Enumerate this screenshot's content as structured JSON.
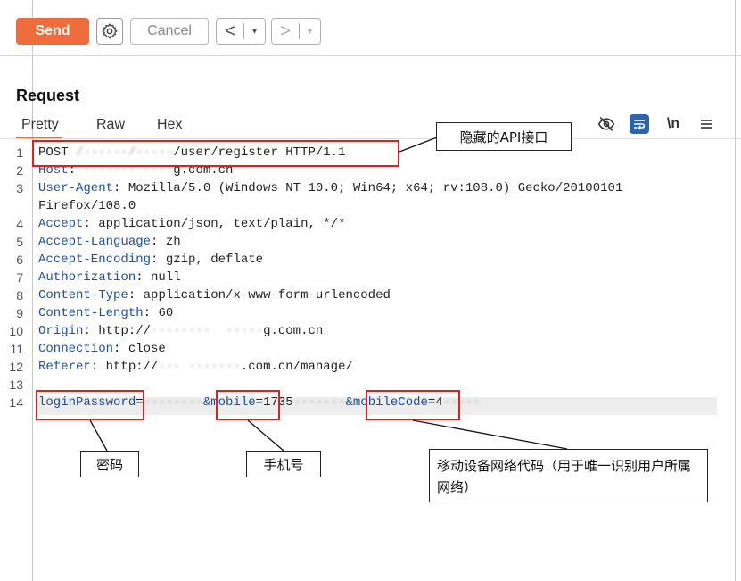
{
  "toolbar": {
    "send_label": "Send",
    "cancel_label": "Cancel",
    "back_glyph": "<",
    "forward_glyph": ">",
    "dropdown_glyph": "▾"
  },
  "request": {
    "title": "Request",
    "tabs": [
      "Pretty",
      "Raw",
      "Hex"
    ],
    "active_tab": "Pretty",
    "icons": [
      "eye-slash-icon",
      "wrap-lines-icon",
      "newline-icon",
      "menu-icon"
    ],
    "newline_label": "\\n"
  },
  "lines": [
    {
      "n": "1",
      "key": "",
      "text": "POST ",
      "blur": "/······/·····",
      "rest": "/user/register HTTP/1.1"
    },
    {
      "n": "2",
      "key": "Host",
      "sep": ": ",
      "blur": "······· ····",
      "rest": "g.com.cn"
    },
    {
      "n": "3",
      "key": "User-Agent",
      "sep": ": ",
      "text": "Mozilla/5.0 (Windows NT 10.0; Win64; x64; rv:108.0) Gecko/20100101"
    },
    {
      "n": "",
      "key": "",
      "text": "Firefox/108.0"
    },
    {
      "n": "4",
      "key": "Accept",
      "sep": ": ",
      "text": "application/json, text/plain, */*"
    },
    {
      "n": "5",
      "key": "Accept-Language",
      "sep": ": ",
      "text": "zh"
    },
    {
      "n": "6",
      "key": "Accept-Encoding",
      "sep": ": ",
      "text": "gzip, deflate"
    },
    {
      "n": "7",
      "key": "Authorization",
      "sep": ": ",
      "text": "null"
    },
    {
      "n": "8",
      "key": "Content-Type",
      "sep": ": ",
      "text": "application/x-www-form-urlencoded"
    },
    {
      "n": "9",
      "key": "Content-Length",
      "sep": ": ",
      "text": "60"
    },
    {
      "n": "10",
      "key": "Origin",
      "sep": ": ",
      "text": "http://",
      "blur": "········  ·····",
      "rest": "g.com.cn"
    },
    {
      "n": "11",
      "key": "Connection",
      "sep": ": ",
      "text": "close"
    },
    {
      "n": "12",
      "key": "Referer",
      "sep": ": ",
      "text": "http://",
      "blur": "··· ·······",
      "rest": ".com.cn/manage/"
    },
    {
      "n": "13",
      "key": "",
      "text": ""
    },
    {
      "n": "14",
      "key": "loginPassword",
      "sep": "=",
      "blur": "········",
      "key2": "&mobile",
      "sep2": "=",
      "val2": "1735",
      "blur2": "·······",
      "key3": "&mobileCode",
      "sep3": "=",
      "val3": "4",
      "blur3": "·····"
    }
  ],
  "annotations": {
    "api": "隐藏的API接口",
    "password": "密码",
    "mobile": "手机号",
    "mobile_code": "移动设备网络代码（用于唯一识别用户所属网络）"
  },
  "colors": {
    "accent": "#ef6c3d",
    "header_key": "#1a4fa6",
    "highlight": "#e02020",
    "wrap_button": "#2b64b1"
  }
}
